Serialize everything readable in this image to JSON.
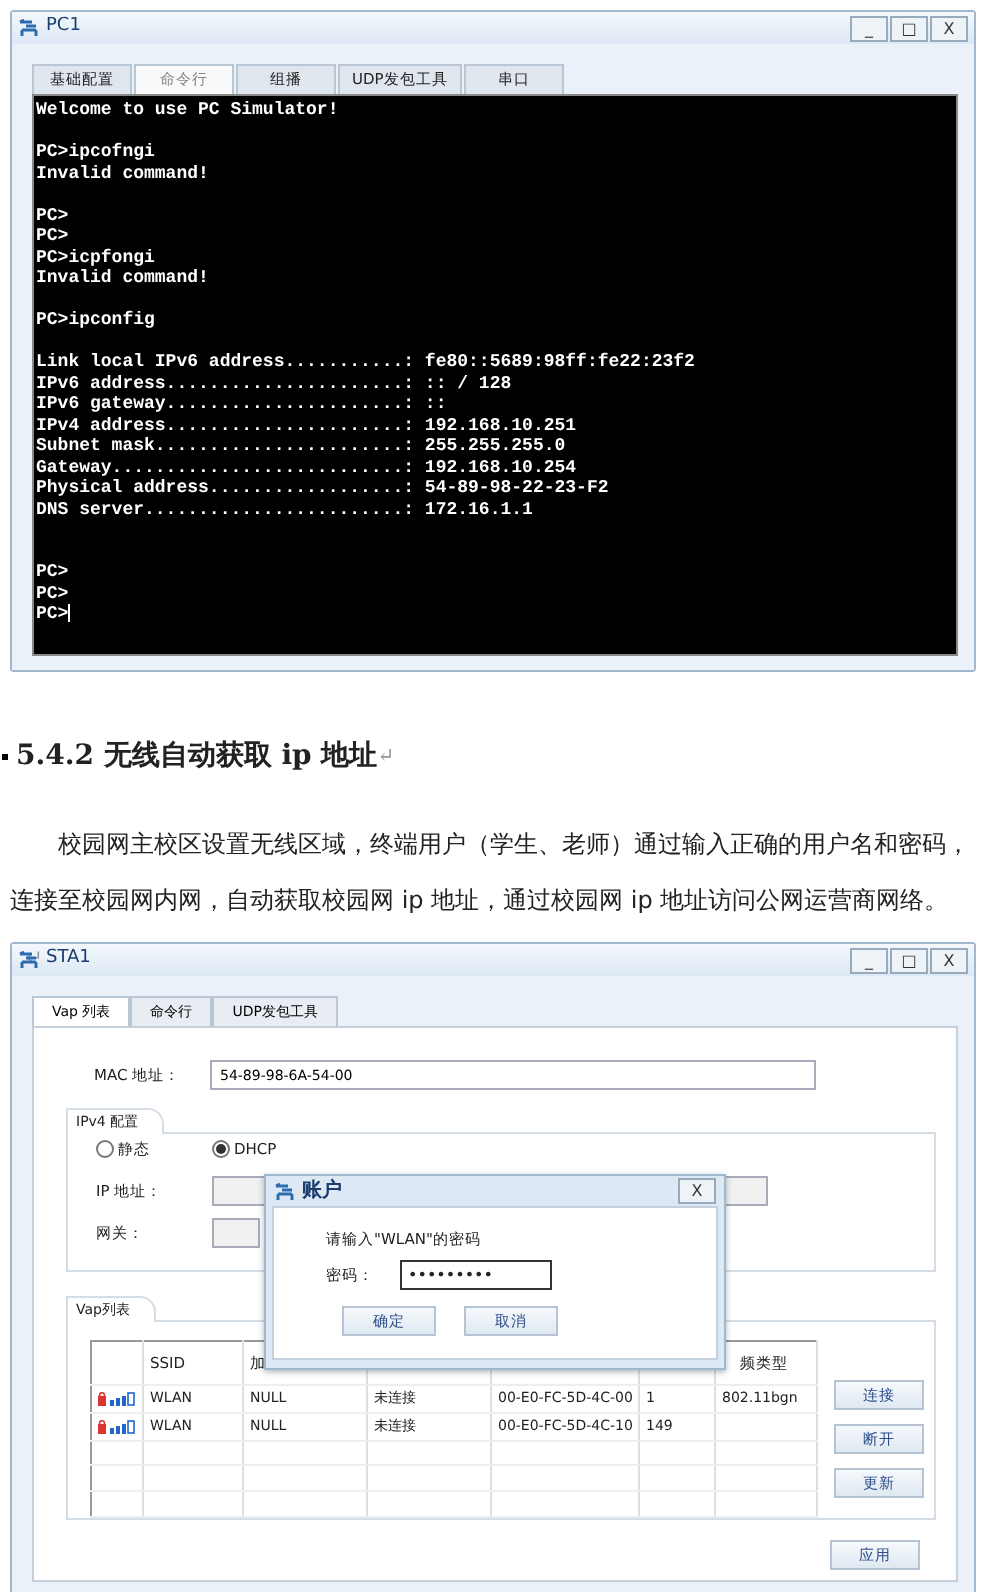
{
  "pc_window": {
    "title": "PC1",
    "controls": [
      "_",
      "□",
      "X"
    ],
    "tabs": [
      {
        "label": "基础配置",
        "selected": false
      },
      {
        "label": "命令行",
        "selected": true
      },
      {
        "label": "组播",
        "selected": false
      },
      {
        "label": "UDP发包工具",
        "selected": false
      },
      {
        "label": "串口",
        "selected": false
      }
    ],
    "terminal": {
      "blocks": [
        {
          "kind": "normal",
          "lines": [
            "Welcome to use PC Simulator!"
          ]
        },
        {
          "kind": "normal",
          "lines": [
            "PC>ipcofngi",
            "Invalid command!"
          ]
        },
        {
          "kind": "normal",
          "lines": [
            "PC>",
            "PC>",
            "PC>icpfongi",
            "Invalid command!"
          ]
        },
        {
          "kind": "normal",
          "lines": [
            "PC>ipconfig"
          ]
        },
        {
          "kind": "normal",
          "lines": [
            "Link local IPv6 address...........: fe80::5689:98ff:fe22:23f2",
            "IPv6 address......................: :: / 128",
            "IPv6 gateway......................: ::",
            "IPv4 address......................: 192.168.10.251",
            "Subnet mask.......................: 255.255.255.0",
            "Gateway...........................: 192.168.10.254",
            "Physical address..................: 54-89-98-22-23-F2",
            "DNS server........................: 172.16.1.1"
          ]
        },
        {
          "kind": "wide",
          "lines": [
            "PC>",
            "PC>",
            "PC>"
          ]
        }
      ],
      "cursor": true
    }
  },
  "section": {
    "heading": "5.4.2 无线自动获取 ip 地址",
    "paragraph": "校园网主校区设置无线区域，终端用户（学生、老师）通过输入正确的用户名和密码，连接至校园网内网，自动获取校园网 ip 地址，通过校园网 ip 地址访问公网运营商网络。",
    "mark": "↵"
  },
  "sta_window": {
    "title": "STA1",
    "controls": [
      "_",
      "□",
      "X"
    ],
    "tabs": [
      {
        "label": "Vap 列表",
        "selected": true
      },
      {
        "label": "命令行",
        "selected": false
      },
      {
        "label": "UDP发包工具",
        "selected": false
      }
    ],
    "mac_label": "MAC 地址：",
    "mac_value": "54-89-98-6A-54-00",
    "ipv4_group": "IPv4 配置",
    "modes": [
      {
        "label": "静态",
        "selected": false
      },
      {
        "label": "DHCP",
        "selected": true
      }
    ],
    "ip_label": "IP 地址：",
    "gateway_label": "网关：",
    "vap_group": "Vap列表",
    "table": {
      "columns": [
        "SSID",
        "加",
        null,
        null,
        null,
        "频类型"
      ],
      "rows": [
        {
          "locked": true,
          "cells": [
            "WLAN",
            "NULL",
            "未连接",
            "00-E0-FC-5D-4C-00",
            "1",
            "802.11bgn"
          ]
        },
        {
          "locked": true,
          "cells": [
            "WLAN",
            "NULL",
            "未连接",
            "00-E0-FC-5D-4C-10",
            "149"
          ]
        }
      ]
    },
    "side_buttons": [
      "连接",
      "断开",
      "更新"
    ],
    "apply_button": "应用"
  },
  "dialog": {
    "title": "账户",
    "close": "X",
    "prompt": "请输入\"WLAN\"的密码",
    "password_label": "密码：",
    "password_value": "•••••••••",
    "buttons": [
      "确定",
      "取消"
    ]
  }
}
